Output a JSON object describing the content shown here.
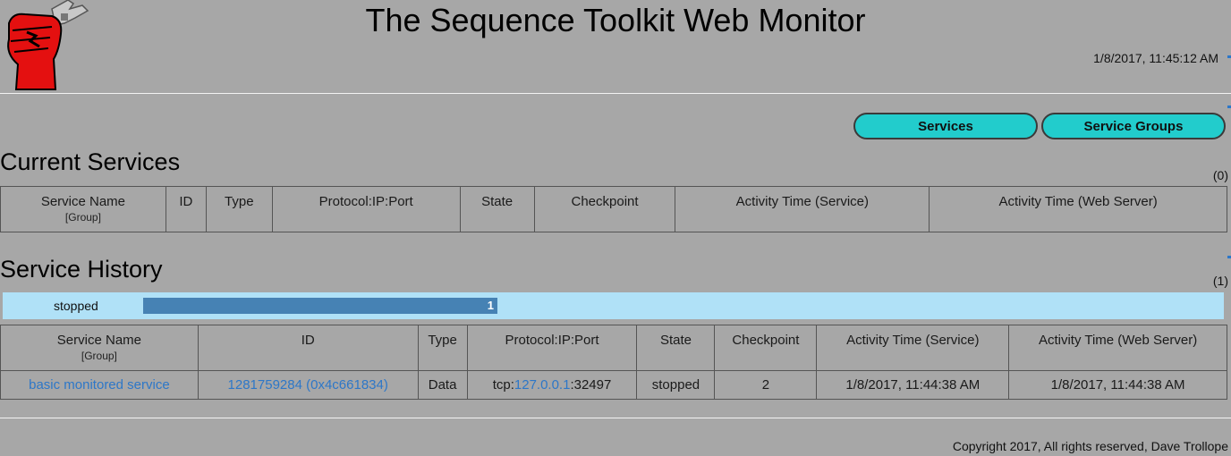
{
  "header": {
    "title": "The Sequence Toolkit Web Monitor",
    "datetime": "1/8/2017, 11:45:12 AM",
    "logo_icon": "red-fist-wrench-logo-icon"
  },
  "nav": {
    "services_label": "Services",
    "service_groups_label": "Service Groups"
  },
  "current_services": {
    "title": "Current Services",
    "count": "(0)",
    "columns": [
      {
        "label": "Service Name",
        "sub": "[Group]"
      },
      {
        "label": "ID"
      },
      {
        "label": "Type"
      },
      {
        "label": "Protocol:IP:Port"
      },
      {
        "label": "State"
      },
      {
        "label": "Checkpoint"
      },
      {
        "label": "Activity Time (Service)"
      },
      {
        "label": "Activity Time (Web Server)"
      }
    ]
  },
  "service_history": {
    "title": "Service History",
    "count": "(1)",
    "state_summary": [
      {
        "state": "stopped",
        "count": "1",
        "fraction": 0.29
      }
    ],
    "columns": [
      {
        "label": "Service Name",
        "sub": "[Group]"
      },
      {
        "label": "ID"
      },
      {
        "label": "Type"
      },
      {
        "label": "Protocol:IP:Port"
      },
      {
        "label": "State"
      },
      {
        "label": "Checkpoint"
      },
      {
        "label": "Activity Time (Service)"
      },
      {
        "label": "Activity Time (Web Server)"
      }
    ],
    "rows": [
      {
        "name": "basic monitored service",
        "id": "1281759284 (0x4c661834)",
        "type": "Data",
        "proto": "tcp:",
        "ip": "127.0.0.1",
        "port": ":32497",
        "state": "stopped",
        "checkpoint": "2",
        "activity_service": "1/8/2017, 11:44:38 AM",
        "activity_web": "1/8/2017, 11:44:38 AM"
      }
    ]
  },
  "footer": {
    "copyright": "Copyright 2017, All rights reserved, Dave Trollope"
  },
  "colors": {
    "background": "#a7a7a7",
    "nav_button": "#22cccc",
    "state_bar_bg": "#b0e1f7",
    "state_bar_fill": "#4682b4",
    "link": "#2d77c8"
  }
}
